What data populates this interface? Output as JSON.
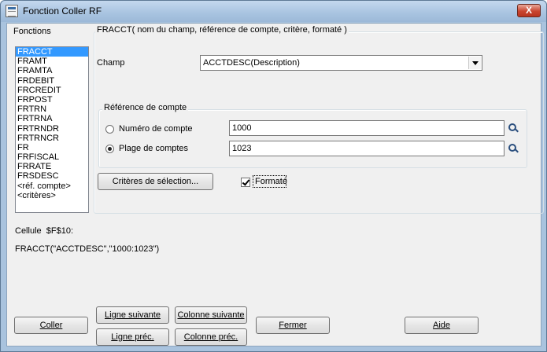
{
  "window": {
    "title": "Fonction Coller RF",
    "close_glyph": "X"
  },
  "functions": {
    "label": "Fonctions",
    "items": [
      "FRACCT",
      "FRAMT",
      "FRAMTA",
      "FRDEBIT",
      "FRCREDIT",
      "FRPOST",
      "FRTRN",
      "FRTRNA",
      "FRTRNDR",
      "FRTRNCR",
      "FR",
      "FRFISCAL",
      "FRRATE",
      "FRSDESC",
      "<réf. compte>",
      "<critères>"
    ],
    "selected": "FRACCT"
  },
  "syntax_group": {
    "legend": "FRACCT( nom du champ, référence de compte, critère, formaté )"
  },
  "champ": {
    "label": "Champ",
    "value": "ACCTDESC(Description)"
  },
  "account_ref": {
    "legend": "Référence de compte",
    "account_number": {
      "label": "Numéro de compte",
      "value": "1000",
      "selected": false
    },
    "account_range": {
      "label": "Plage de comptes",
      "value": "1023",
      "selected": true
    }
  },
  "criteria_button": "Critères de sélection...",
  "formatted": {
    "label": "Formaté",
    "checked": true
  },
  "cell": {
    "label": "Cellule",
    "ref": "$F$10:",
    "formula": "FRACCT(\"ACCTDESC\",\"1000:1023\")"
  },
  "buttons": {
    "paste": "Coller",
    "next_row": "Ligne suivante",
    "prev_row": "Ligne préc.",
    "next_col": "Colonne suivante",
    "prev_col": "Colonne préc.",
    "close": "Fermer",
    "help": "Aide"
  }
}
